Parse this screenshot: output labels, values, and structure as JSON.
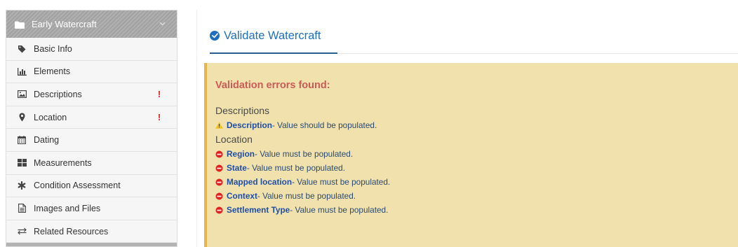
{
  "sidebar": {
    "header": {
      "title": "Early Watercraft",
      "icon": "folder-icon",
      "chevron": "chevron-down-icon"
    },
    "items": [
      {
        "label": "Basic Info",
        "icon": "tag-icon",
        "error": ""
      },
      {
        "label": "Elements",
        "icon": "bar-chart-icon",
        "error": ""
      },
      {
        "label": "Descriptions",
        "icon": "image-icon",
        "error": "!"
      },
      {
        "label": "Location",
        "icon": "map-marker-icon",
        "error": "!"
      },
      {
        "label": "Dating",
        "icon": "calendar-icon",
        "error": ""
      },
      {
        "label": "Measurements",
        "icon": "grid-icon",
        "error": ""
      },
      {
        "label": "Condition Assessment",
        "icon": "asterisk-icon",
        "error": ""
      },
      {
        "label": "Images and Files",
        "icon": "file-icon",
        "error": ""
      },
      {
        "label": "Related Resources",
        "icon": "exchange-icon",
        "error": ""
      }
    ]
  },
  "main": {
    "title": "Validate Watercraft",
    "alert": {
      "heading": "Validation errors found:",
      "groups": [
        {
          "name": "Descriptions",
          "rows": [
            {
              "level": "warning",
              "field": "Description",
              "message": " - Value should be populated."
            }
          ]
        },
        {
          "name": "Location",
          "rows": [
            {
              "level": "error",
              "field": "Region",
              "message": " - Value must be populated."
            },
            {
              "level": "error",
              "field": "State",
              "message": " - Value must be populated."
            },
            {
              "level": "error",
              "field": "Mapped location",
              "message": " - Value must be populated."
            },
            {
              "level": "error",
              "field": "Context",
              "message": " - Value must be populated."
            },
            {
              "level": "error",
              "field": "Settlement Type",
              "message": " - Value must be populated."
            }
          ]
        }
      ]
    }
  },
  "colors": {
    "accent": "#1f6fbf",
    "alert_bg": "#f0e1ad",
    "alert_border": "#e7b64b",
    "heading_red": "#cc5b57",
    "error_red": "#e0231f",
    "warning_yellow": "#f3c11a"
  }
}
